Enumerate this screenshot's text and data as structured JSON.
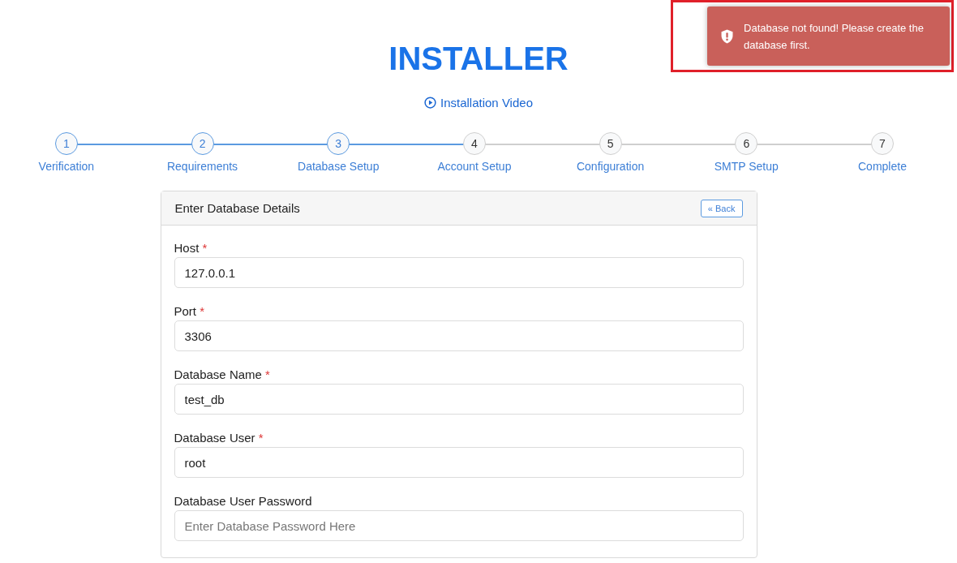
{
  "title": "INSTALLER",
  "video_link": "Installation Video",
  "steps": [
    {
      "number": "1",
      "label": "Verification",
      "active": true
    },
    {
      "number": "2",
      "label": "Requirements",
      "active": true
    },
    {
      "number": "3",
      "label": "Database Setup",
      "active": true
    },
    {
      "number": "4",
      "label": "Account Setup",
      "active": false
    },
    {
      "number": "5",
      "label": "Configuration",
      "active": false
    },
    {
      "number": "6",
      "label": "SMTP Setup",
      "active": false
    },
    {
      "number": "7",
      "label": "Complete",
      "active": false
    }
  ],
  "card": {
    "title": "Enter Database Details",
    "back_button": "« Back",
    "fields": [
      {
        "label": "Host",
        "required_mark": "*",
        "value": "127.0.0.1"
      },
      {
        "label": "Port",
        "required_mark": "*",
        "value": "3306"
      },
      {
        "label": "Database Name",
        "required_mark": "*",
        "value": "test_db"
      },
      {
        "label": "Database User",
        "required_mark": "*",
        "value": "root"
      },
      {
        "label": "Database User Password",
        "placeholder": "Enter Database Password Here"
      }
    ]
  },
  "toast": {
    "message": "Database not found! Please create the database first.",
    "highlighted": true
  }
}
